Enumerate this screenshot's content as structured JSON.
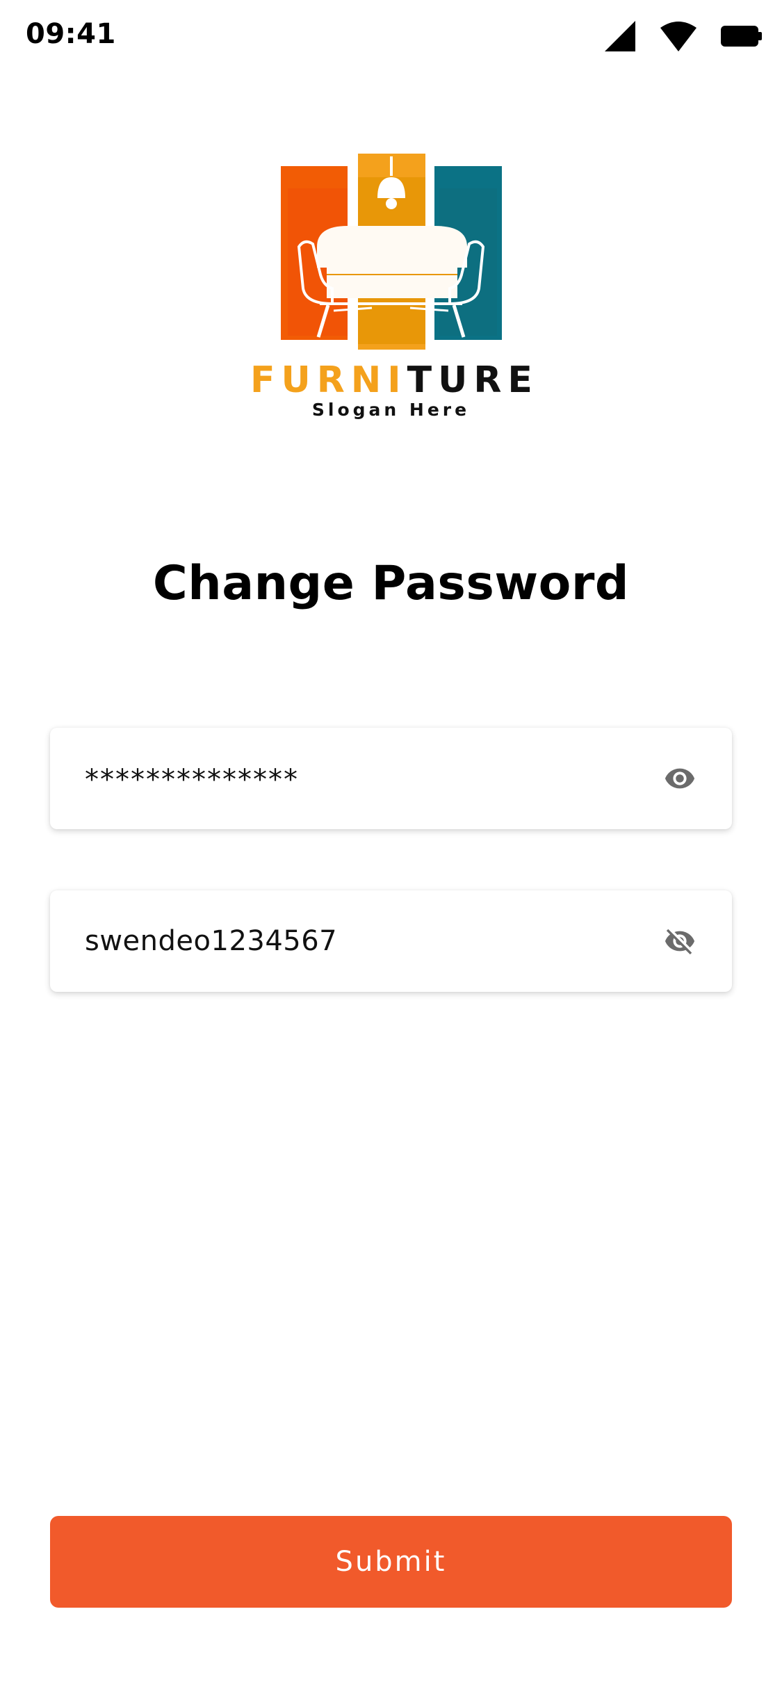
{
  "status_bar": {
    "time": "09:41",
    "icons": [
      "cellular-signal-icon",
      "wifi-icon",
      "battery-icon"
    ]
  },
  "logo": {
    "word_part1": "FURNI",
    "word_part2": "TURE",
    "slogan": "Slogan Here",
    "colors": {
      "left_panel": "#f25c05",
      "middle_panel": "#f4a11c",
      "right_panel": "#0b7285",
      "word_accent": "#f4a11c"
    }
  },
  "page": {
    "title": "Change Password"
  },
  "form": {
    "current_password": {
      "value": "**************",
      "toggle_icon": "eye-icon"
    },
    "new_password": {
      "value": "swendeo1234567",
      "toggle_icon": "eye-off-icon"
    },
    "submit_label": "Submit"
  },
  "colors": {
    "accent": "#f15a2b",
    "background": "#ffffff",
    "icon_gray": "#6b6b6b"
  }
}
